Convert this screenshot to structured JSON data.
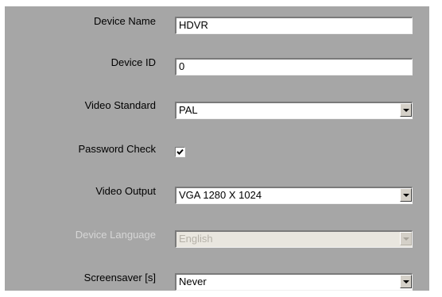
{
  "settings": {
    "device_name": {
      "label": "Device Name",
      "value": "HDVR"
    },
    "device_id": {
      "label": "Device ID",
      "value": "0"
    },
    "video_standard": {
      "label": "Video Standard",
      "value": "PAL"
    },
    "password_check": {
      "label": "Password Check",
      "checked": true
    },
    "video_output": {
      "label": "Video Output",
      "value": "VGA 1280 X 1024"
    },
    "device_language": {
      "label": "Device Language",
      "value": "English",
      "disabled": true
    },
    "screensaver": {
      "label": "Screensaver [s]",
      "value": "Never"
    }
  },
  "colors": {
    "panel_background": "#a6a6a6",
    "disabled_label": "#d6d6d6",
    "disabled_field": "#e9e6df"
  }
}
